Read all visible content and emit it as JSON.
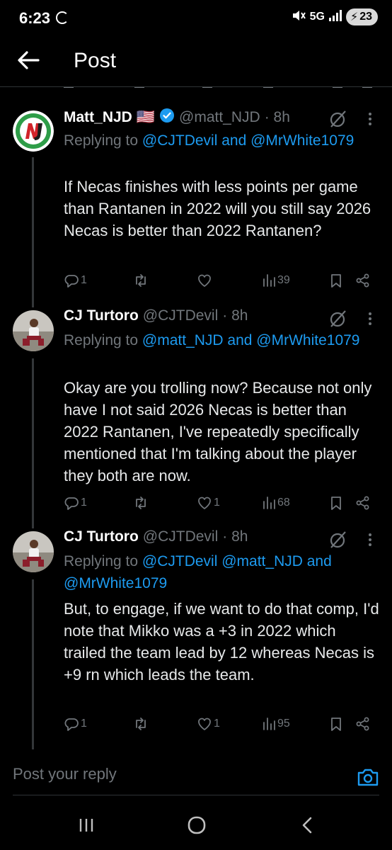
{
  "status_bar": {
    "time": "6:23",
    "network": "5G",
    "battery": "23"
  },
  "header": {
    "title": "Post"
  },
  "posts": [
    {
      "name": "Matt_NJD",
      "flag": "🇺🇸",
      "handle": "@matt_NJD",
      "time": "· 8h",
      "replying_prefix": "Replying to",
      "replying_to": "@CJTDevil and @MrWhite1079",
      "text": "If Necas finishes with less points per game than Rantanen in 2022 will you still say 2026 Necas is better than 2022 Rantanen?",
      "replies": "1",
      "reposts": "",
      "likes": "",
      "views": "39"
    },
    {
      "name": "CJ Turtoro",
      "handle": "@CJTDevil",
      "time": "· 8h",
      "replying_prefix": "Replying to",
      "replying_to": "@matt_NJD and @MrWhite1079",
      "text": "Okay are you trolling now? Because not only have I not said 2026 Necas is better than 2022 Rantanen, I've repeatedly specifically mentioned that I'm talking about the player they both are now.",
      "replies": "1",
      "reposts": "",
      "likes": "1",
      "views": "68"
    },
    {
      "name": "CJ Turtoro",
      "handle": "@CJTDevil",
      "time": "· 8h",
      "replying_prefix": "Replying to",
      "replying_to": "@CJTDevil @matt_NJD and @MrWhite1079",
      "text": "But, to engage, if we want to do that comp, I'd note that Mikko was a +3 in 2022 which trailed the team lead by 12 whereas Necas is +9 rn which leads the team.",
      "replies": "1",
      "reposts": "",
      "likes": "1",
      "views": "95"
    }
  ],
  "reply_bar": {
    "placeholder": "Post your reply"
  },
  "icons": {
    "back": "arrow-left-icon",
    "grok": "grok-icon",
    "more": "more-vertical-icon",
    "reply": "comment-icon",
    "repost": "repost-icon",
    "like": "heart-icon",
    "views": "views-icon",
    "bookmark": "bookmark-icon",
    "share": "share-icon",
    "camera": "camera-icon"
  },
  "colors": {
    "background": "#000000",
    "text": "#e7e9ea",
    "muted": "#71767b",
    "link": "#1d9bf0"
  }
}
